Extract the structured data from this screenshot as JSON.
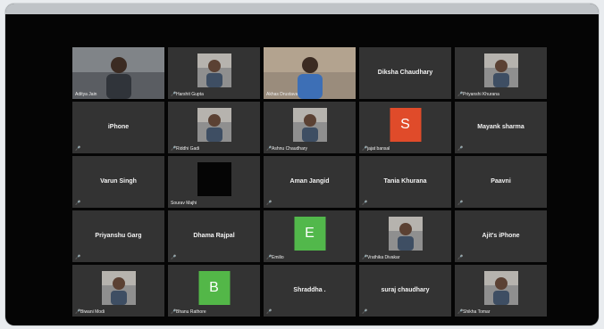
{
  "participants": [
    {
      "name": "Aditya Jain",
      "mode": "video",
      "label": "Aditya Jain",
      "active": true
    },
    {
      "name": "Harshit Gupta",
      "mode": "photo",
      "label": "Harshit Gupta",
      "muted": true
    },
    {
      "name": "Akhas Drustava",
      "mode": "video",
      "label": "Akhas Drustava"
    },
    {
      "name": "Diksha Chaudhary",
      "mode": "text",
      "label": ""
    },
    {
      "name": "Priyanshi Khurana",
      "mode": "photo",
      "label": "Priyanshi Khurana",
      "muted": true
    },
    {
      "name": "iPhone",
      "mode": "text",
      "label": "",
      "muted": true
    },
    {
      "name": "Riddhi Gadi",
      "mode": "photo",
      "label": "Riddhi Gadi",
      "muted": true
    },
    {
      "name": "Ashnu Chaudhary",
      "mode": "photo",
      "label": "Ashnu Chaudhary",
      "muted": true
    },
    {
      "name": "jajat bansal",
      "mode": "avatar",
      "letter": "S",
      "color": "#e04b2a",
      "label": "jajat bansal",
      "muted": true
    },
    {
      "name": "Mayank sharma",
      "mode": "text",
      "label": "",
      "muted": true
    },
    {
      "name": "Varun Singh",
      "mode": "text",
      "label": "",
      "muted": true
    },
    {
      "name": "Sourav Majhi",
      "mode": "black",
      "label": "Sourav Majhi"
    },
    {
      "name": "Aman Jangid",
      "mode": "text",
      "label": "",
      "muted": true
    },
    {
      "name": "Tania Khurana",
      "mode": "text",
      "label": "",
      "muted": true
    },
    {
      "name": "Paavni",
      "mode": "text",
      "label": "",
      "muted": true
    },
    {
      "name": "Priyanshu Garg",
      "mode": "text",
      "label": "",
      "muted": true
    },
    {
      "name": "Dhama Rajpal",
      "mode": "text",
      "label": "",
      "muted": true
    },
    {
      "name": "Emilio",
      "mode": "avatar",
      "letter": "E",
      "color": "#52b84b",
      "label": "Emilio",
      "muted": true
    },
    {
      "name": "Vrathika Divakar",
      "mode": "photo",
      "label": "Vrathika Divakar",
      "muted": true
    },
    {
      "name": "Ajit's iPhone",
      "mode": "text",
      "label": "",
      "muted": true
    },
    {
      "name": "Biwani Modi",
      "mode": "photo",
      "label": "Biwani Modi",
      "muted": true
    },
    {
      "name": "Bhanu Rathore",
      "mode": "avatar",
      "letter": "B",
      "color": "#53b748",
      "label": "Bhanu Rathore",
      "muted": true
    },
    {
      "name": "Shraddha .",
      "mode": "text",
      "label": "",
      "muted": true
    },
    {
      "name": "suraj chaudhary",
      "mode": "text",
      "label": "",
      "muted": true
    },
    {
      "name": "Shikha Tomar",
      "mode": "photo",
      "label": "Shikha Tomar",
      "muted": true
    }
  ],
  "colors": {
    "active_border": "#c7df4f",
    "tile_bg": "#333333",
    "mic_muted": "#e0363c"
  }
}
